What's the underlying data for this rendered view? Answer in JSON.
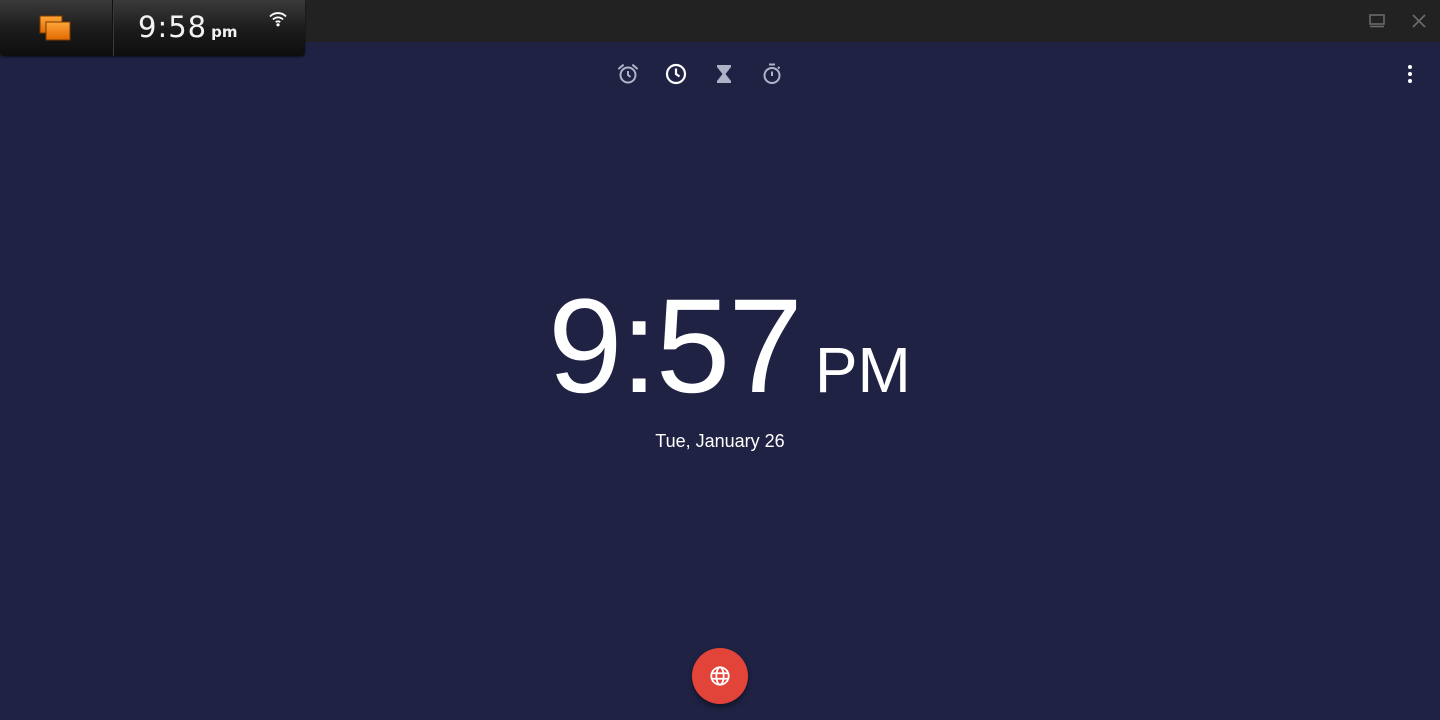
{
  "system_bar": {
    "time": "9:58",
    "ampm": "pm"
  },
  "clock": {
    "time": "9:57",
    "ampm": "PM",
    "date": "Tue, January 26"
  },
  "tabs": [
    {
      "icon": "alarm-icon",
      "selected": false
    },
    {
      "icon": "clock-icon",
      "selected": true
    },
    {
      "icon": "hourglass-icon",
      "selected": false
    },
    {
      "icon": "stopwatch-icon",
      "selected": false
    }
  ],
  "colors": {
    "background": "#202244",
    "fab": "#e2443a",
    "inactive_icon": "#b0b3c8",
    "active_icon": "#ffffff",
    "launcher_accent": "#f07c00"
  },
  "fab": {
    "icon": "globe-icon"
  }
}
